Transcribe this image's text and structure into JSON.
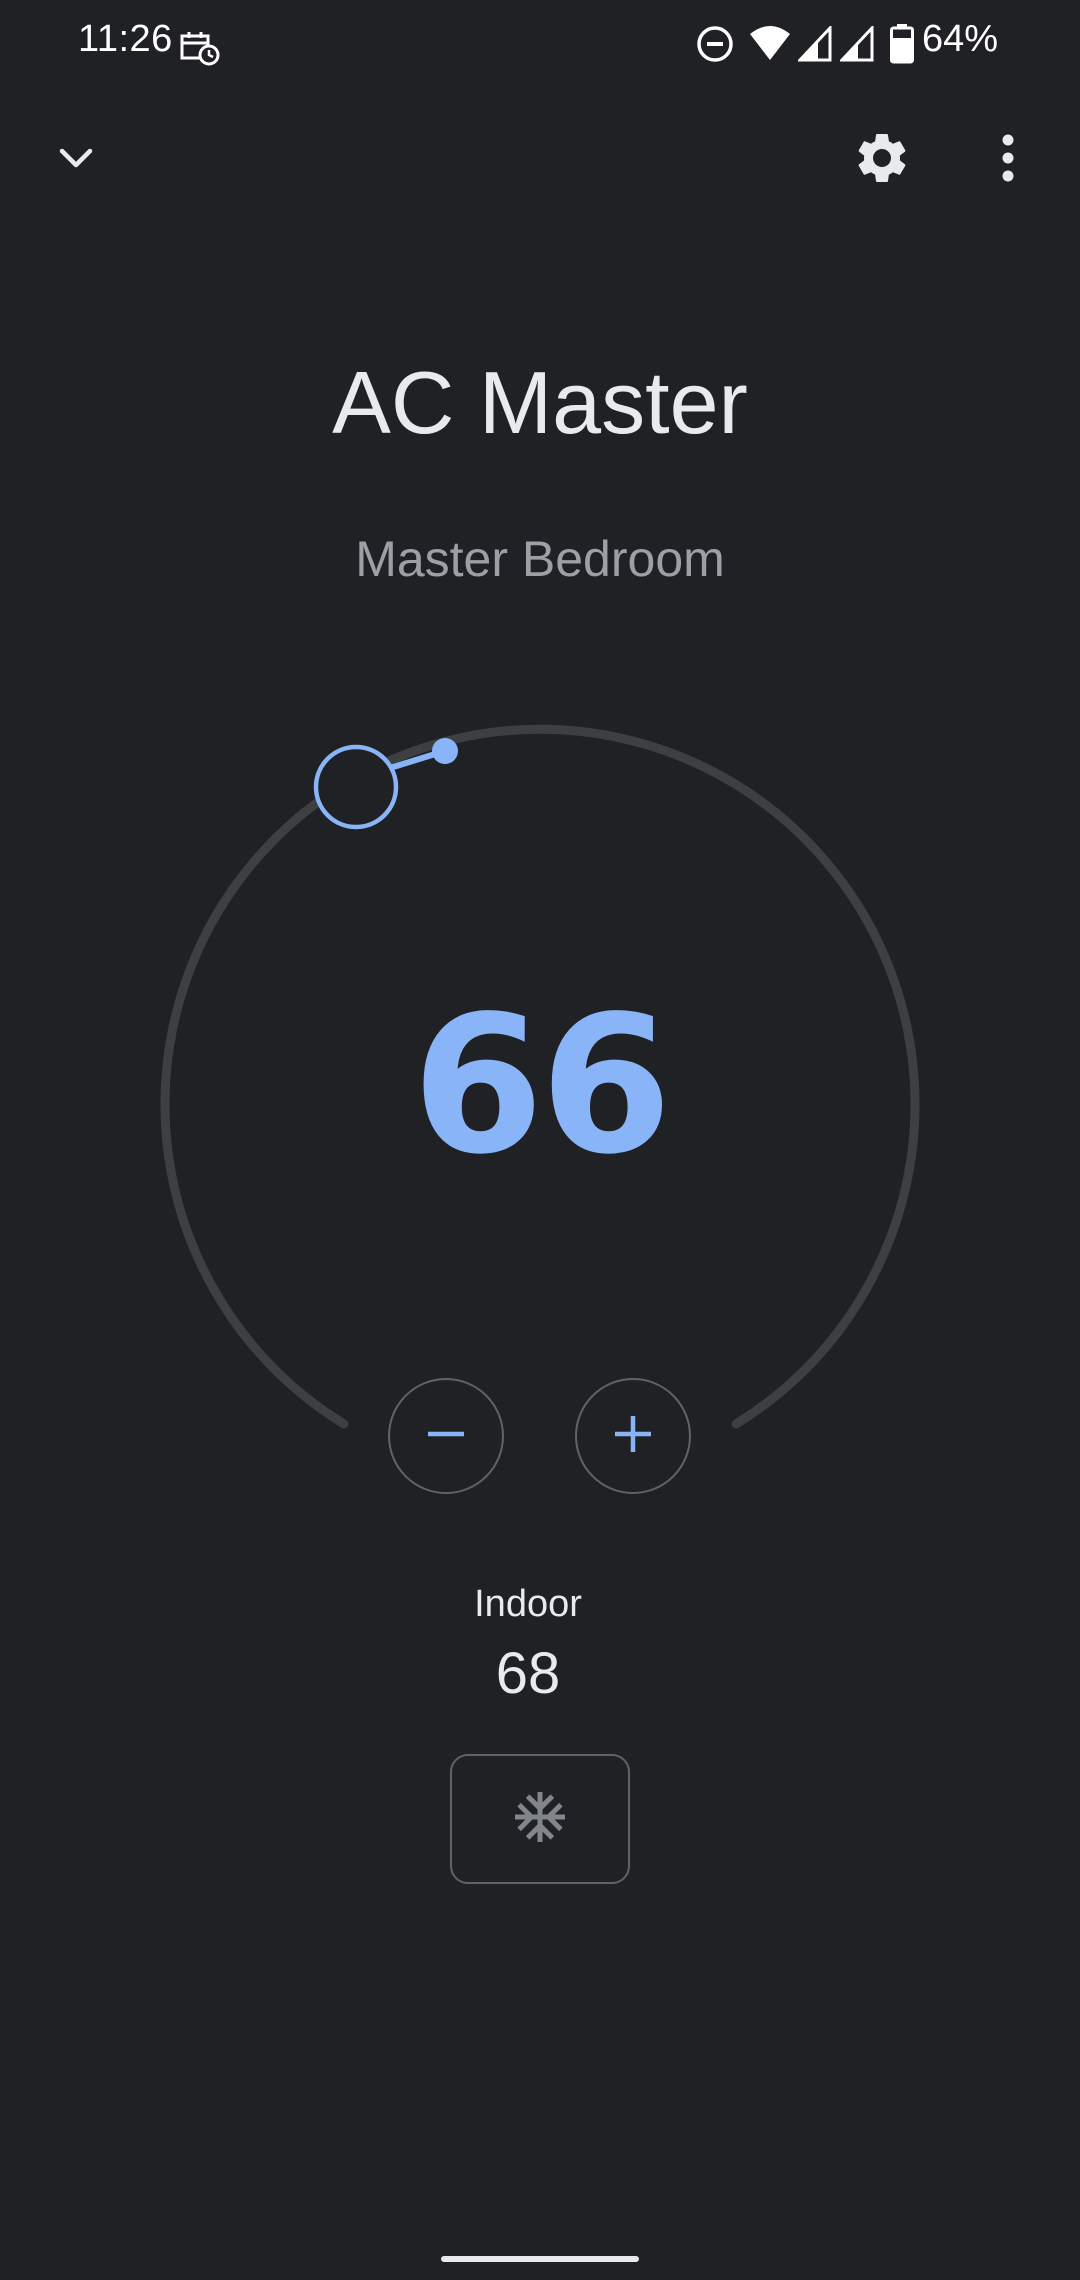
{
  "status_bar": {
    "time": "11:26",
    "battery_percent": "64%",
    "icons": [
      "calendar-clock-icon",
      "do-not-disturb-icon",
      "wifi-icon",
      "cell-signal-icon",
      "cell-signal-icon",
      "battery-icon"
    ]
  },
  "top_bar": {
    "icons": [
      "chevron-down-icon",
      "gear-icon",
      "more-vert-icon"
    ]
  },
  "device": {
    "name": "AC Master",
    "room": "Master Bedroom"
  },
  "thermostat": {
    "setpoint": "66",
    "indoor_label": "Indoor",
    "indoor_value": "68",
    "mode_icon": "snowflake-icon",
    "accent_color": "#8ab4f8",
    "track_color": "#3c4043"
  },
  "controls": {
    "decrease_icon": "minus-icon",
    "increase_icon": "plus-icon"
  }
}
